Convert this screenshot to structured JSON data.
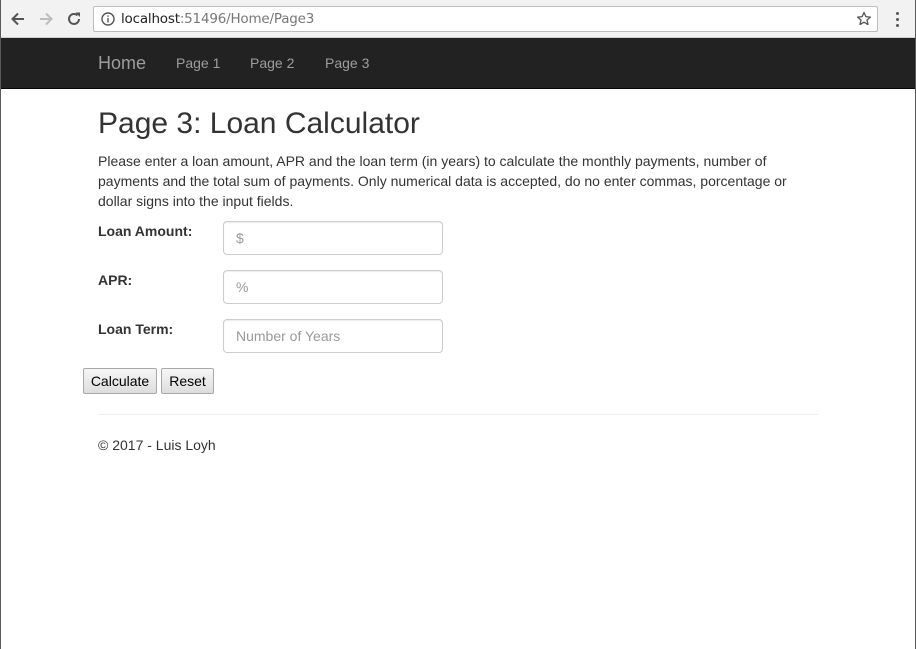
{
  "browser": {
    "url_host": "localhost",
    "url_path": ":51496/Home/Page3"
  },
  "navbar": {
    "brand": "Home",
    "links": [
      "Page 1",
      "Page 2",
      "Page 3"
    ]
  },
  "main": {
    "title": "Page 3: Loan Calculator",
    "intro": "Please enter a loan amount, APR and the loan term (in years) to calculate the monthly payments, number of payments and the total sum of payments. Only numerical data is accepted, do no enter commas, porcentage or dollar signs into the input fields.",
    "fields": [
      {
        "label": "Loan Amount:",
        "placeholder": "$",
        "value": ""
      },
      {
        "label": "APR:",
        "placeholder": "%",
        "value": ""
      },
      {
        "label": "Loan Term:",
        "placeholder": "Number of Years",
        "value": ""
      }
    ],
    "buttons": {
      "calculate": "Calculate",
      "reset": "Reset"
    }
  },
  "footer": {
    "text": "© 2017 - Luis Loyh"
  },
  "colors": {
    "navbar_bg": "#222222",
    "nav_text": "#9d9d9d",
    "body_text": "#333333"
  }
}
